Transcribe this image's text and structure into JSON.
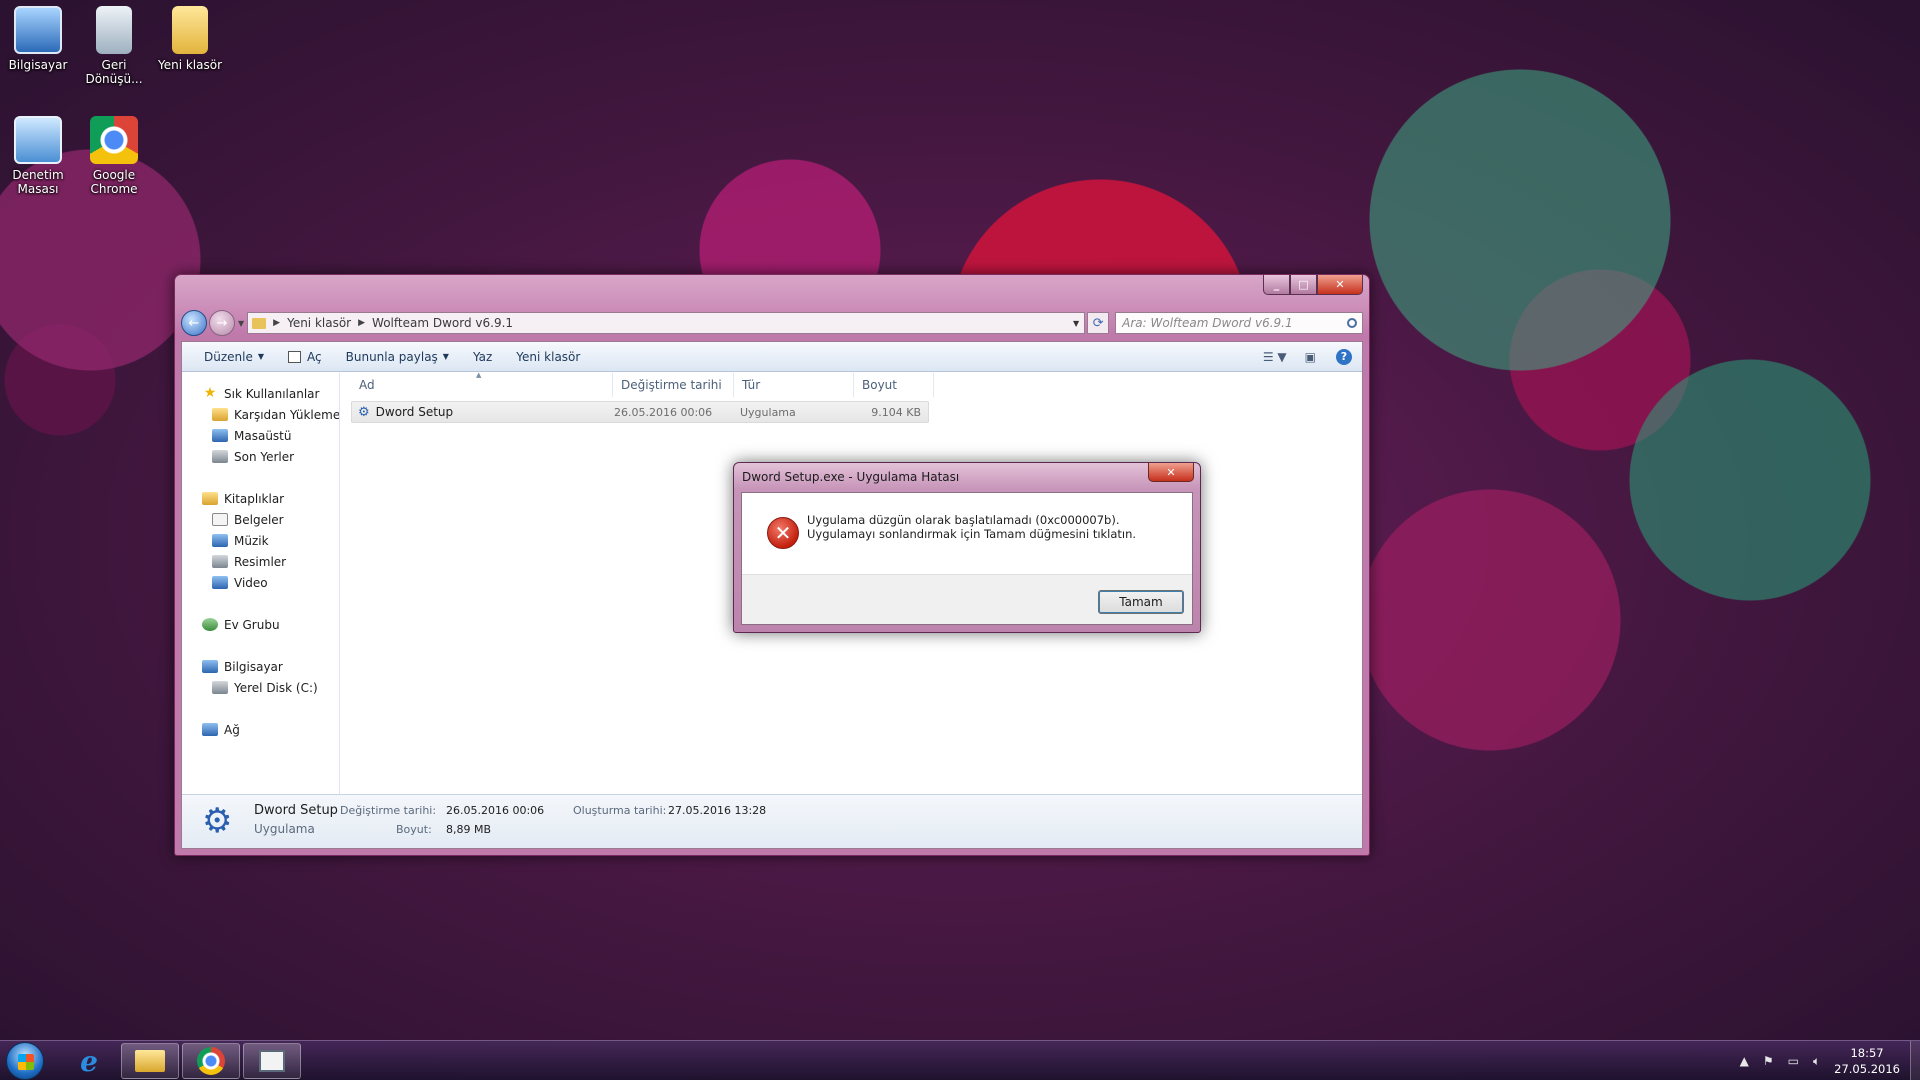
{
  "desktop": {
    "icons": [
      {
        "label": "Bilgisayar"
      },
      {
        "label": "Geri Dönüşü..."
      },
      {
        "label": "Yeni klasör"
      },
      {
        "label": "Denetim Masası"
      },
      {
        "label": "Google Chrome"
      }
    ]
  },
  "explorer": {
    "breadcrumb": [
      "Yeni klasör",
      "Wolfteam Dword v6.9.1"
    ],
    "search_placeholder": "Ara: Wolfteam Dword v6.9.1",
    "toolbar": {
      "organize": "Düzenle",
      "open": "Aç",
      "share": "Bununla paylaş",
      "burn": "Yaz",
      "new_folder": "Yeni klasör"
    },
    "nav": {
      "favorites": "Sık Kullanılanlar",
      "downloads": "Karşıdan Yüklemeler",
      "desktop": "Masaüstü",
      "recent": "Son Yerler",
      "libraries": "Kitaplıklar",
      "documents": "Belgeler",
      "music": "Müzik",
      "pictures": "Resimler",
      "video": "Video",
      "homegroup": "Ev Grubu",
      "computer": "Bilgisayar",
      "local_disk": "Yerel Disk (C:)",
      "network": "Ağ"
    },
    "columns": {
      "name": "Ad",
      "modified": "Değiştirme tarihi",
      "type": "Tür",
      "size": "Boyut"
    },
    "files": [
      {
        "name": "Dword Setup",
        "modified": "26.05.2016 00:06",
        "type": "Uygulama",
        "size": "9.104 KB"
      }
    ],
    "details": {
      "name": "Dword Setup",
      "type": "Uygulama",
      "modified_label": "Değiştirme tarihi:",
      "modified_value": "26.05.2016 00:06",
      "size_label": "Boyut:",
      "size_value": "8,89 MB",
      "created_label": "Oluşturma tarihi:",
      "created_value": "27.05.2016 13:28"
    }
  },
  "dialog": {
    "title": "Dword Setup.exe - Uygulama Hatası",
    "message": "Uygulama düzgün olarak başlatılamadı (0xc000007b). Uygulamayı sonlandırmak için Tamam düğmesini tıklatın.",
    "ok_label": "Tamam"
  },
  "taskbar": {
    "time": "18:57",
    "date": "27.05.2016"
  }
}
